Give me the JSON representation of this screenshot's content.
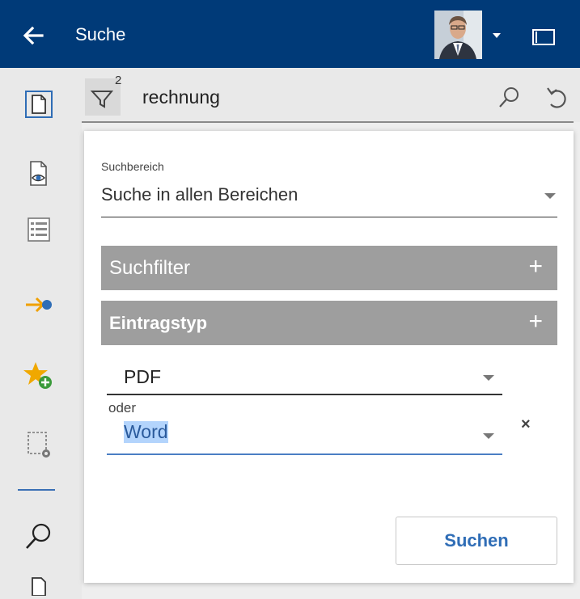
{
  "header": {
    "title": "Suche",
    "back_icon": "arrow-left-icon",
    "avatar_icon": "user-avatar",
    "caret_icon": "caret-down-icon",
    "panel_icon": "panel-toggle-icon",
    "background": "#003a78"
  },
  "sidebar": {
    "items": [
      {
        "icon": "document-icon",
        "active": true
      },
      {
        "icon": "document-preview-icon"
      },
      {
        "icon": "list-view-icon"
      },
      {
        "icon": "arrow-dot-icon"
      },
      {
        "icon": "favorite-add-icon"
      },
      {
        "icon": "selection-settings-icon"
      },
      {
        "icon": "search-icon"
      },
      {
        "icon": "document-icon"
      }
    ]
  },
  "searchbar": {
    "filter_icon": "filter-icon",
    "filter_count": "2",
    "query": "rechnung",
    "search_icon": "search-icon",
    "reset_icon": "reset-icon"
  },
  "panel": {
    "area_label": "Suchbereich",
    "area_value": "Suche in allen Bereichen",
    "section_filter": "Suchfilter",
    "section_type": "Eintragstyp",
    "type_first": "PDF",
    "or_label": "oder",
    "type_second": "Word",
    "remove_symbol": "×",
    "submit_label": "Suchen"
  },
  "colors": {
    "accent": "#2f6db6",
    "section_bg": "#9e9e9e",
    "sidebar_bg": "#e9e9e9"
  }
}
